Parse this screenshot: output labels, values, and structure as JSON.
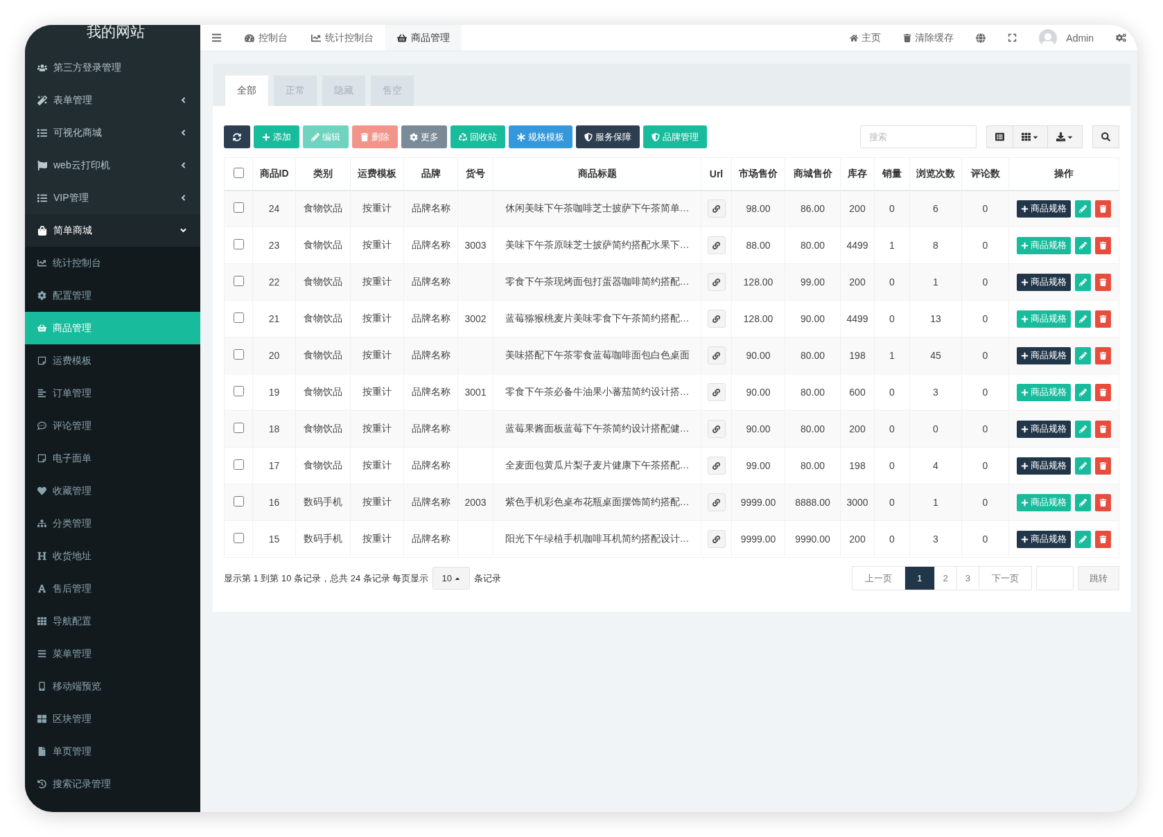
{
  "sidebar": {
    "logo": "我的网站",
    "items": [
      {
        "kind": "link",
        "label": "第三方登录管理",
        "selected": false
      },
      {
        "kind": "group",
        "label": "表单管理",
        "expanded": false,
        "selected": false
      },
      {
        "kind": "group",
        "label": "可视化商城",
        "expanded": false,
        "selected": false
      },
      {
        "kind": "group",
        "label": "web云打印机",
        "expanded": false,
        "selected": false
      },
      {
        "kind": "group",
        "label": "VIP管理",
        "expanded": false,
        "selected": false
      },
      {
        "kind": "group",
        "label": "简单商城",
        "expanded": true,
        "selected": false,
        "children": [
          {
            "label": "统计控制台",
            "selected": false
          },
          {
            "label": "配置管理",
            "selected": false
          },
          {
            "label": "商品管理",
            "selected": true
          },
          {
            "label": "运费模板",
            "selected": false
          },
          {
            "label": "订单管理",
            "selected": false
          },
          {
            "label": "评论管理",
            "selected": false
          },
          {
            "label": "电子面单",
            "selected": false
          },
          {
            "label": "收藏管理",
            "selected": false
          },
          {
            "label": "分类管理",
            "selected": false
          },
          {
            "label": "收货地址",
            "selected": false
          },
          {
            "label": "售后管理",
            "selected": false
          },
          {
            "label": "导航配置",
            "selected": false
          },
          {
            "label": "菜单管理",
            "selected": false
          },
          {
            "label": "移动端预览",
            "selected": false
          },
          {
            "label": "区块管理",
            "selected": false
          },
          {
            "label": "单页管理",
            "selected": false
          },
          {
            "label": "搜索记录管理",
            "selected": false
          }
        ]
      }
    ]
  },
  "topbar": {
    "tabs": [
      {
        "label": "控制台",
        "selected": false
      },
      {
        "label": "统计控制台",
        "selected": false
      },
      {
        "label": "商品管理",
        "selected": true
      }
    ],
    "links": [
      "主页",
      "清除缓存"
    ],
    "user": "Admin"
  },
  "panel": {
    "tabs": [
      {
        "label": "全部",
        "selected": true
      },
      {
        "label": "正常",
        "selected": false
      },
      {
        "label": "隐藏",
        "selected": false
      },
      {
        "label": "售空",
        "selected": false
      }
    ],
    "toolbar": [
      {
        "kind": "refresh",
        "color": "#2c3e50"
      },
      {
        "kind": "add",
        "label": "添加",
        "color": "#18bc9c"
      },
      {
        "kind": "edit",
        "label": "编辑",
        "color": "#6fd3bf"
      },
      {
        "kind": "delete",
        "label": "删除",
        "color": "#f1958b"
      },
      {
        "kind": "more",
        "label": "更多",
        "color": "#7b8a97"
      },
      {
        "kind": "recycle",
        "label": "回收站",
        "color": "#18bc9c"
      },
      {
        "kind": "spec",
        "label": "规格模板",
        "color": "#3498db"
      },
      {
        "kind": "shield",
        "label": "服务保障",
        "color": "#2c3e50"
      },
      {
        "kind": "shield",
        "label": "品牌管理",
        "color": "#18bc9c"
      }
    ],
    "search": {
      "placeholder": "搜索"
    },
    "table": {
      "select_all": {
        "checked": false
      },
      "columns": [
        "商品ID",
        "类别",
        "运费模板",
        "品牌",
        "货号",
        "商品标题",
        "Url",
        "市场售价",
        "商城售价",
        "库存",
        "销量",
        "浏览次数",
        "评论数",
        "操作"
      ],
      "rows": [
        {
          "checked": false,
          "id": "24",
          "category": "食物饮品",
          "shipping": "按重计",
          "brand": "品牌名称",
          "title": "休闲美味下午茶咖啡芝士披萨下午茶简单…",
          "market_price": "98.00",
          "shop_price": "86.00",
          "stock": "200",
          "sales": "0",
          "views": "6",
          "comments": "0",
          "spec_button": {
            "label": "商品规格",
            "color": "#22364a"
          }
        },
        {
          "checked": false,
          "id": "23",
          "category": "食物饮品",
          "shipping": "按重计",
          "brand": "品牌名称",
          "sku": "3003",
          "title": "美味下午茶原味芝士披萨简约搭配水果下…",
          "market_price": "88.00",
          "shop_price": "80.00",
          "stock": "4499",
          "sales": "1",
          "views": "8",
          "comments": "0",
          "spec_button": {
            "label": "商品规格",
            "color": "#18bc9c"
          }
        },
        {
          "checked": false,
          "id": "22",
          "category": "食物饮品",
          "shipping": "按重计",
          "brand": "品牌名称",
          "title": "零食下午茶现烤面包打蛋器咖啡简约搭配…",
          "market_price": "128.00",
          "shop_price": "99.00",
          "stock": "200",
          "sales": "0",
          "views": "1",
          "comments": "0",
          "spec_button": {
            "label": "商品规格",
            "color": "#22364a"
          }
        },
        {
          "checked": false,
          "id": "21",
          "category": "食物饮品",
          "shipping": "按重计",
          "brand": "品牌名称",
          "sku": "3002",
          "title": "蓝莓猕猴桃麦片美味零食下午茶简约搭配…",
          "market_price": "128.00",
          "shop_price": "90.00",
          "stock": "4499",
          "sales": "0",
          "views": "13",
          "comments": "0",
          "spec_button": {
            "label": "商品规格",
            "color": "#18bc9c"
          }
        },
        {
          "checked": false,
          "id": "20",
          "category": "食物饮品",
          "shipping": "按重计",
          "brand": "品牌名称",
          "title": "美味搭配下午茶零食蓝莓咖啡面包白色桌面",
          "market_price": "90.00",
          "shop_price": "80.00",
          "stock": "198",
          "sales": "1",
          "views": "45",
          "comments": "0",
          "spec_button": {
            "label": "商品规格",
            "color": "#22364a"
          }
        },
        {
          "checked": false,
          "id": "19",
          "category": "食物饮品",
          "shipping": "按重计",
          "brand": "品牌名称",
          "sku": "3001",
          "title": "零食下午茶必备牛油果小蕃茄简约设计搭…",
          "market_price": "90.00",
          "shop_price": "80.00",
          "stock": "600",
          "sales": "0",
          "views": "3",
          "comments": "0",
          "spec_button": {
            "label": "商品规格",
            "color": "#18bc9c"
          }
        },
        {
          "checked": false,
          "id": "18",
          "category": "食物饮品",
          "shipping": "按重计",
          "brand": "品牌名称",
          "title": "蓝莓果酱面板蓝莓下午茶简约设计搭配健…",
          "market_price": "90.00",
          "shop_price": "80.00",
          "stock": "200",
          "sales": "0",
          "views": "0",
          "comments": "0",
          "spec_button": {
            "label": "商品规格",
            "color": "#22364a"
          }
        },
        {
          "checked": false,
          "id": "17",
          "category": "食物饮品",
          "shipping": "按重计",
          "brand": "品牌名称",
          "title": "全麦面包黄瓜片梨子麦片健康下午茶搭配…",
          "market_price": "99.00",
          "shop_price": "80.00",
          "stock": "198",
          "sales": "0",
          "views": "4",
          "comments": "0",
          "spec_button": {
            "label": "商品规格",
            "color": "#22364a"
          }
        },
        {
          "checked": false,
          "id": "16",
          "category": "数码手机",
          "shipping": "按重计",
          "brand": "品牌名称",
          "sku": "2003",
          "title": "紫色手机彩色桌布花瓶桌面摆饰简约搭配…",
          "market_price": "9999.00",
          "shop_price": "8888.00",
          "stock": "3000",
          "sales": "0",
          "views": "1",
          "comments": "0",
          "spec_button": {
            "label": "商品规格",
            "color": "#18bc9c"
          }
        },
        {
          "checked": false,
          "id": "15",
          "category": "数码手机",
          "shipping": "按重计",
          "brand": "品牌名称",
          "title": "阳光下午绿植手机咖啡耳机简约搭配设计…",
          "market_price": "9999.00",
          "shop_price": "9990.00",
          "stock": "200",
          "sales": "0",
          "views": "3",
          "comments": "0",
          "spec_button": {
            "label": "商品规格",
            "color": "#22364a"
          }
        }
      ]
    },
    "pagination": {
      "summary": "显示第 1 到第 10 条记录，总共 24 条记录 每页显示",
      "page_size": "10",
      "suffix": "条记录",
      "prev": "上一页",
      "pages": [
        {
          "label": "1",
          "selected": true
        },
        {
          "label": "2",
          "selected": false
        },
        {
          "label": "3",
          "selected": false
        }
      ],
      "next": "下一页",
      "jump": "跳转"
    }
  }
}
